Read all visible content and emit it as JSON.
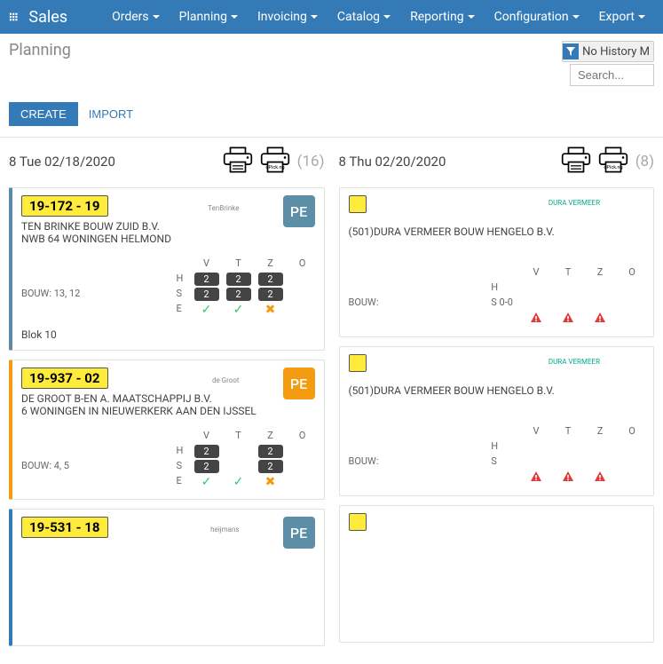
{
  "brand": "Sales",
  "nav": [
    "Orders",
    "Planning",
    "Invoicing",
    "Catalog",
    "Reporting",
    "Configuration",
    "Export"
  ],
  "page_title": "Planning",
  "filter_label": "No History M",
  "search_placeholder": "Search...",
  "create_label": "CREATE",
  "import_label": "IMPORT",
  "columns": [
    {
      "date": "8 Tue 02/18/2020",
      "count": "(16)",
      "cards": [
        {
          "tag": "19-172 - 19",
          "line1": "TEN BRINKE BOUW ZUID B.V.",
          "line2": "NWB 64 WONINGEN HELMOND",
          "logo": "TenBrinke",
          "pe": "PE",
          "pe_color": "",
          "bouw": "BOUW: 13, 12",
          "blok": "Blok 10",
          "hse": [
            "H",
            "S",
            "E"
          ],
          "cols": [
            "V",
            "T",
            "Z",
            "O"
          ],
          "grid": [
            [
              "2",
              "2",
              "2",
              ""
            ],
            [
              "2",
              "2",
              "2",
              ""
            ],
            [
              "ok",
              "ok",
              "warn",
              ""
            ]
          ],
          "border": "c1"
        },
        {
          "tag": "19-937 - 02",
          "line1": "DE GROOT B-EN A. MAATSCHAPPIJ B.V.",
          "line2": "6 WONINGEN IN NIEUWERKERK AAN DEN IJSSEL",
          "logo": "de Groot",
          "pe": "PE",
          "pe_color": "orange",
          "bouw": "BOUW: 4, 5",
          "blok": "",
          "hse": [
            "H",
            "S",
            "E"
          ],
          "cols": [
            "V",
            "T",
            "Z",
            "O"
          ],
          "grid": [
            [
              "2",
              "",
              "2",
              ""
            ],
            [
              "2",
              "",
              "2",
              ""
            ],
            [
              "ok",
              "ok",
              "warn",
              ""
            ]
          ],
          "border": "c2"
        },
        {
          "tag": "19-531 - 18",
          "line1": "",
          "line2": "",
          "logo": "heijmans",
          "pe": "PE",
          "pe_color": "",
          "bouw": "",
          "blok": "",
          "hse": [],
          "cols": [],
          "grid": [],
          "border": "c3"
        }
      ]
    },
    {
      "date": "8 Thu 02/20/2020",
      "count": "(8)",
      "cards": [
        {
          "tag": "",
          "line1": "(501)DURA VERMEER BOUW HENGELO B.V.",
          "line2": "",
          "logo": "DURA VERMEER",
          "pe": "",
          "bouw": "BOUW:",
          "hse_labels": [
            "H",
            "S 0-0"
          ],
          "cols": [
            "V",
            "T",
            "Z",
            "O"
          ],
          "err_row": true
        },
        {
          "tag": "",
          "line1": "(501)DURA VERMEER BOUW HENGELO B.V.",
          "line2": "",
          "logo": "DURA VERMEER",
          "pe": "",
          "bouw": "BOUW:",
          "hse_labels": [
            "H",
            "S"
          ],
          "cols": [
            "V",
            "T",
            "Z",
            "O"
          ],
          "err_row": true
        },
        {
          "tag": "",
          "line1": "",
          "err_row": false
        }
      ]
    }
  ]
}
